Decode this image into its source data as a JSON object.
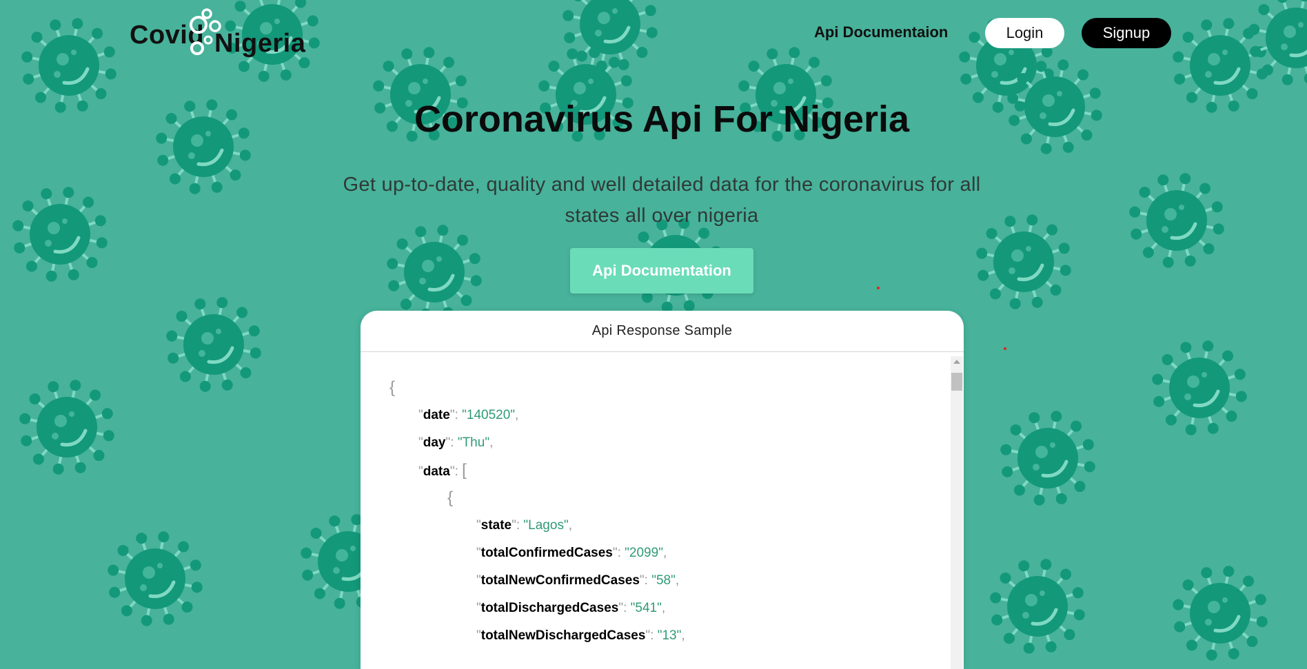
{
  "brand": {
    "word1": "Covid",
    "word2": "Nigeria",
    "ring_color": "#ffffff"
  },
  "colors": {
    "background": "#48b29b",
    "virus_body": "#13987a",
    "virus_highlight": "#7fd9c2",
    "primary_button": "#6bdcb8",
    "json_value": "#2f9a78",
    "dot": "#e0241b"
  },
  "nav": {
    "api_doc_link": "Api Documentaion",
    "login_label": "Login",
    "signup_label": "Signup"
  },
  "hero": {
    "title": "Coronavirus Api For Nigeria",
    "subtitle": "Get up-to-date, quality and well detailed data for the coronavirus for all states all over nigeria",
    "cta_label": "Api Documentation"
  },
  "sample": {
    "heading": "Api Response Sample",
    "open_brace": "{",
    "inner_brace": "{",
    "date_key": "date",
    "date_value": "140520",
    "day_key": "day",
    "day_value": "Thu",
    "data_key": "data",
    "data_open": "[",
    "state_key": "state",
    "state_value": "Lagos",
    "tcc_key": "totalConfirmedCases",
    "tcc_value": "2099",
    "tncc_key": "totalNewConfirmedCases",
    "tncc_value": "58",
    "tdc_key": "totalDischargedCases",
    "tdc_value": "541",
    "tndc_key": "totalNewDischargedCases",
    "tndc_value": "13"
  },
  "background_icon": "virus-icon"
}
